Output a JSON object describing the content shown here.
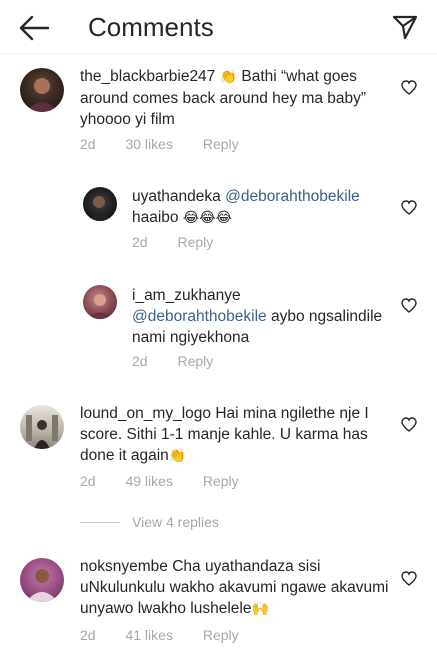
{
  "header": {
    "title": "Comments"
  },
  "comments": [
    {
      "username": "the_blackbarbie247",
      "emoji": "👏",
      "text": "Bathi “what goes around comes back around hey ma baby” yhoooo yi film",
      "time": "2d",
      "likes": "30 likes",
      "reply": "Reply"
    },
    {
      "username": "uyathandeka",
      "mention": "@deborahthobekile",
      "text": "haaibo",
      "emoji": "😂😂😂",
      "time": "2d",
      "reply": "Reply"
    },
    {
      "username": "i_am_zukhanye",
      "mention": "@deborahthobekile",
      "text": "aybo ngsalindile nami ngiyekhona",
      "time": "2d",
      "reply": "Reply"
    },
    {
      "username": "lound_on_my_logo",
      "text": "Hai mina ngilethe nje I score. Sithi 1-1 manje kahle. U karma has done it again",
      "emoji": "👏",
      "time": "2d",
      "likes": "49 likes",
      "reply": "Reply"
    },
    {
      "username": "noksnyembe",
      "text": "Cha uyathandaza sisi uNkulunkulu wakho akavumi ngawe akavumi unyawo lwakho lushelele",
      "emoji": "🙌",
      "time": "2d",
      "likes": "41 likes",
      "reply": "Reply"
    }
  ],
  "view_replies": "View 4 replies",
  "icons": [
    "back-arrow-icon",
    "send-icon",
    "heart-icon"
  ]
}
